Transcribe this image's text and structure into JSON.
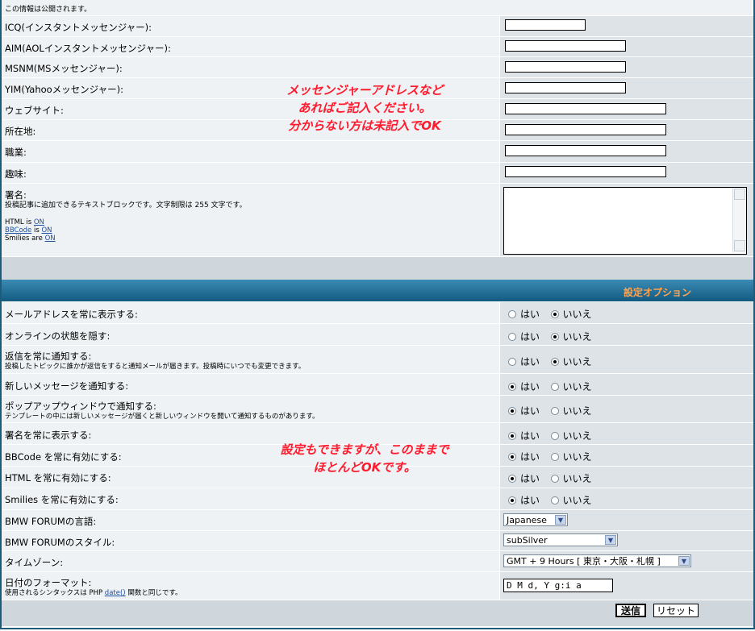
{
  "notice": "この情報は公開されます。",
  "profile": {
    "icq": "ICQ(インスタントメッセンジャー):",
    "aim": "AIM(AOLインスタントメッセンジャー):",
    "msnm": "MSNM(MSメッセンジャー):",
    "yim": "YIM(Yahooメッセンジャー):",
    "website": "ウェブサイト:",
    "location": "所在地:",
    "occupation": "職業:",
    "interests": "趣味:",
    "signature": "署名:",
    "signature_desc": "投稿記事に追加できるテキストブロックです。文字制限は 255 文字です。",
    "html_prefix": "HTML is",
    "html_state": "ON",
    "bbcode_link": "BBCode",
    "bbcode_mid": "is",
    "bbcode_state": "ON",
    "smilies_prefix": "Smilies are",
    "smilies_state": "ON"
  },
  "annotation_top": [
    "メッセンジャーアドレスなど",
    "あればご記入ください。",
    "分からない方は未記入でOK"
  ],
  "annotation_mid": [
    "設定もできますが、このままで",
    "ほとんどOKです。"
  ],
  "options_header": "設定オプション",
  "options": [
    {
      "label": "メールアドレスを常に表示する:",
      "sub": "",
      "yes": "はい",
      "no": "いいえ",
      "selected": "no"
    },
    {
      "label": "オンラインの状態を隠す:",
      "sub": "",
      "yes": "はい",
      "no": "いいえ",
      "selected": "no"
    },
    {
      "label": "返信を常に通知する:",
      "sub": "投稿したトピックに誰かが返信をすると通知メールが届きます。投稿時にいつでも変更できます。",
      "yes": "はい",
      "no": "いいえ",
      "selected": "no"
    },
    {
      "label": "新しいメッセージを通知する:",
      "sub": "",
      "yes": "はい",
      "no": "いいえ",
      "selected": "yes"
    },
    {
      "label": "ポップアップウィンドウで通知する:",
      "sub": "テンプレートの中には新しいメッセージが届くと新しいウィンドウを開いて通知するものがあります。",
      "yes": "はい",
      "no": "いいえ",
      "selected": "yes"
    },
    {
      "label": "署名を常に表示する:",
      "sub": "",
      "yes": "はい",
      "no": "いいえ",
      "selected": "yes"
    },
    {
      "label": "BBCode を常に有効にする:",
      "sub": "",
      "yes": "はい",
      "no": "いいえ",
      "selected": "yes"
    },
    {
      "label": "HTML を常に有効にする:",
      "sub": "",
      "yes": "はい",
      "no": "いいえ",
      "selected": "yes"
    },
    {
      "label": "Smilies を常に有効にする:",
      "sub": "",
      "yes": "はい",
      "no": "いいえ",
      "selected": "yes"
    }
  ],
  "language": {
    "label": "BMW FORUMの言語:",
    "value": "Japanese"
  },
  "style": {
    "label": "BMW FORUMのスタイル:",
    "value": "subSilver"
  },
  "timezone": {
    "label": "タイムゾーン:",
    "value": "GMT + 9 Hours [ 東京・大阪・札幌 ]"
  },
  "dateformat": {
    "label": "日付のフォーマット:",
    "sub_prefix": "使用されるシンタックスは PHP",
    "sub_link": "date()",
    "sub_suffix": "関数と同じです。",
    "value": "D M d, Y g:i a"
  },
  "buttons": {
    "submit": "送信",
    "reset": "リセット"
  },
  "colors": {
    "header": "#1a6d94",
    "header_text": "#ffa34f",
    "annotation": "#ff1a2e",
    "label_bg": "#eef2f4",
    "value_bg": "#dee3e7"
  }
}
